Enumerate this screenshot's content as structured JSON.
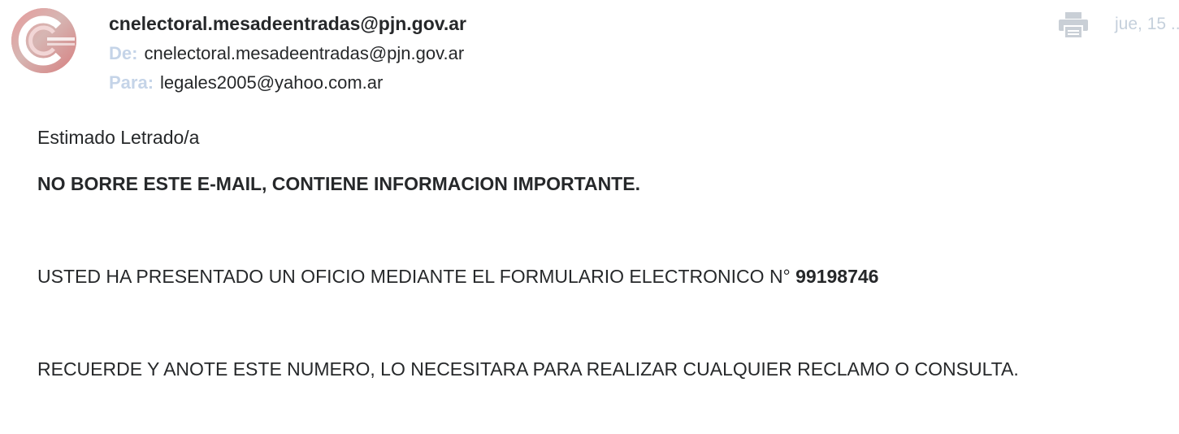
{
  "header": {
    "sender_name": "cnelectoral.mesadeentradas@pjn.gov.ar",
    "from_label": "De:",
    "from_value": "cnelectoral.mesadeentradas@pjn.gov.ar",
    "to_label": "Para:",
    "to_value": "legales2005@yahoo.com.ar",
    "date": "jue, 15 ...",
    "print_icon": "print-icon",
    "avatar_icon": "sender-logo"
  },
  "body": {
    "greeting": "Estimado Letrado/a",
    "warning": "NO BORRE ESTE E-MAIL, CONTIENE INFORMACION IMPORTANTE.",
    "oficio_text": "USTED HA PRESENTADO UN OFICIO MEDIANTE EL FORMULARIO ELECTRONICO N°",
    "oficio_number": "99198746",
    "reminder": "RECUERDE Y ANOTE ESTE NUMERO, LO NECESITARA PARA REALIZAR CUALQUIER RECLAMO O CONSULTA."
  },
  "colors": {
    "label": "#c5d4e8",
    "text": "#26282a",
    "date": "#c5d0dc",
    "icon": "#c9cfd6"
  }
}
